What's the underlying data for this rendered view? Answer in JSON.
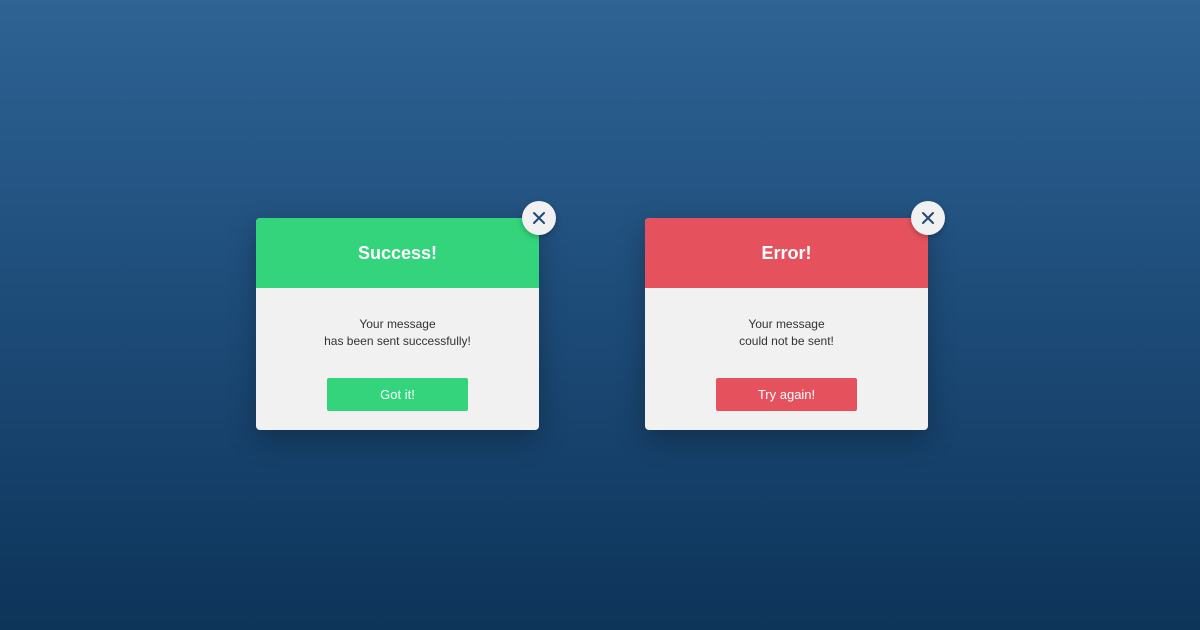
{
  "success_dialog": {
    "title": "Success!",
    "message_line1": "Your message",
    "message_line2": "has been sent successfully!",
    "button_label": "Got it!",
    "accent_color": "#33d47b",
    "close_icon": "close-icon"
  },
  "error_dialog": {
    "title": "Error!",
    "message_line1": "Your message",
    "message_line2": "could not be sent!",
    "button_label": "Try again!",
    "accent_color": "#e5525e",
    "close_icon": "close-icon"
  }
}
